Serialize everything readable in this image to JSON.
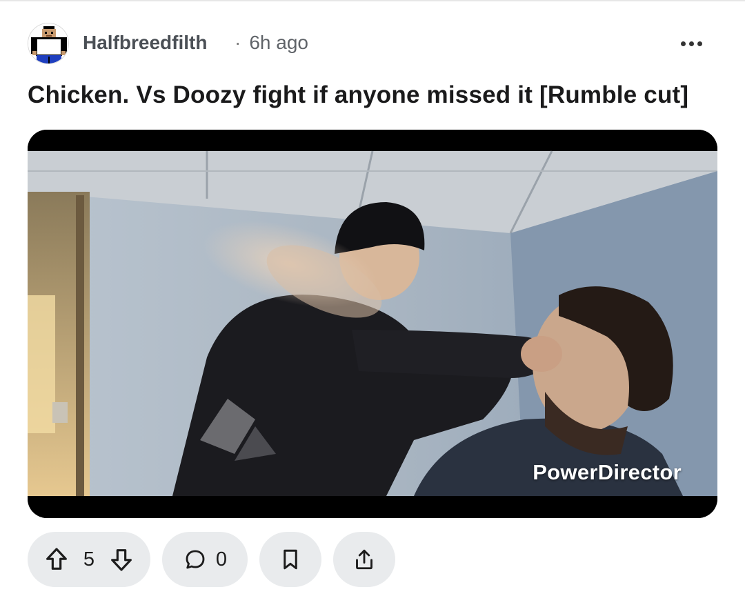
{
  "post": {
    "author": "Halfbreedfilth",
    "separator": "·",
    "time": "6h ago",
    "title": "Chicken. Vs Doozy fight if anyone missed it [Rumble cut]"
  },
  "media": {
    "watermark": "PowerDirector"
  },
  "actions": {
    "vote_count": "5",
    "comment_count": "0"
  },
  "icons": {
    "avatar": "pixel-avatar",
    "more": "more-horizontal-icon",
    "upvote": "arrow-up-icon",
    "downvote": "arrow-down-icon",
    "comment": "comment-bubble-icon",
    "save": "bookmark-icon",
    "share": "share-icon"
  },
  "colors": {
    "pill_bg": "#e9ebed",
    "author": "#4a4f55",
    "title": "#1a1a1b"
  }
}
